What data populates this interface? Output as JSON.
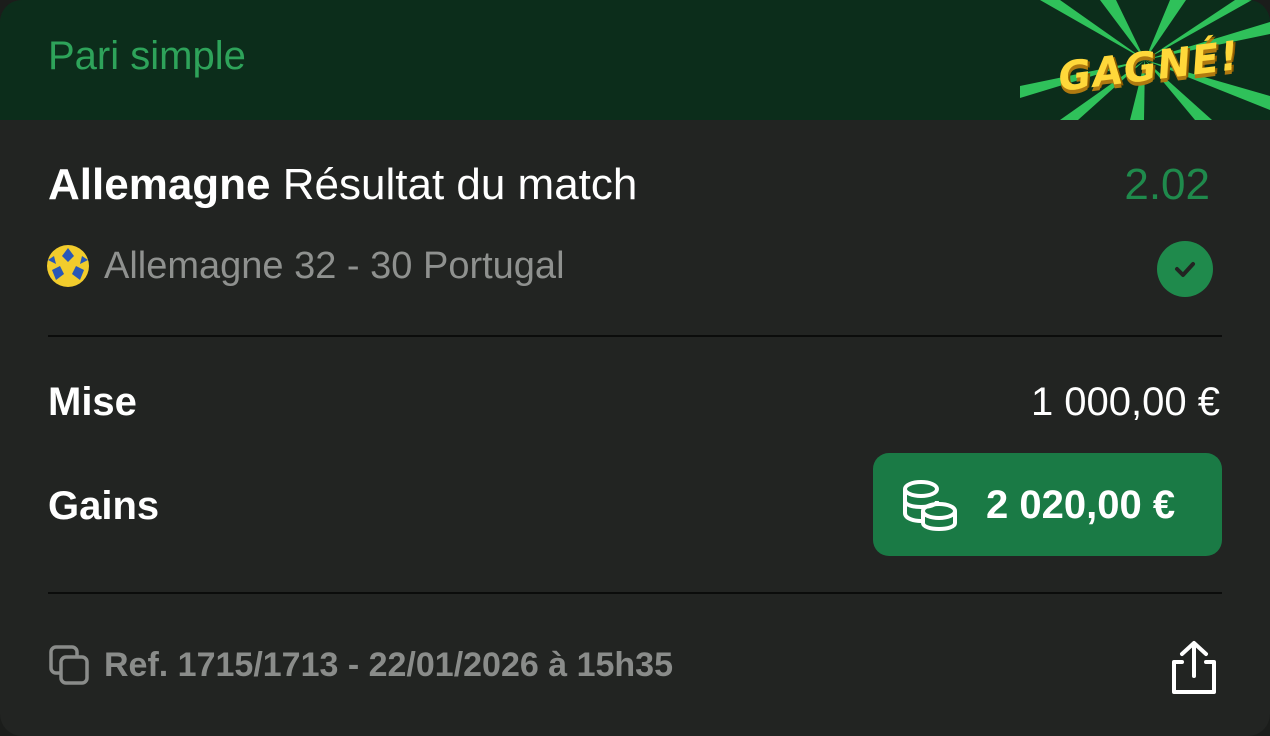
{
  "header": {
    "bet_type": "Pari simple",
    "status_badge": "GAGNÉ!"
  },
  "selection": {
    "team": "Allemagne",
    "market": "Résultat du match",
    "odds": "2.02"
  },
  "match": {
    "sport_icon": "handball-icon",
    "text": "Allemagne 32 - 30 Portugal",
    "status_icon": "check-circle-icon"
  },
  "stake": {
    "label": "Mise",
    "value": "1 000,00 €"
  },
  "gains": {
    "label": "Gains",
    "icon": "coins-icon",
    "value": "2 020,00 €"
  },
  "footer": {
    "copy_icon": "copy-icon",
    "reference": "Ref. 1715/1713 - 22/01/2026 à 15h35",
    "share_icon": "share-icon"
  },
  "colors": {
    "accent_green": "#2ea35a",
    "gains_green": "#1a7a45",
    "badge_yellow": "#ffd83a"
  }
}
